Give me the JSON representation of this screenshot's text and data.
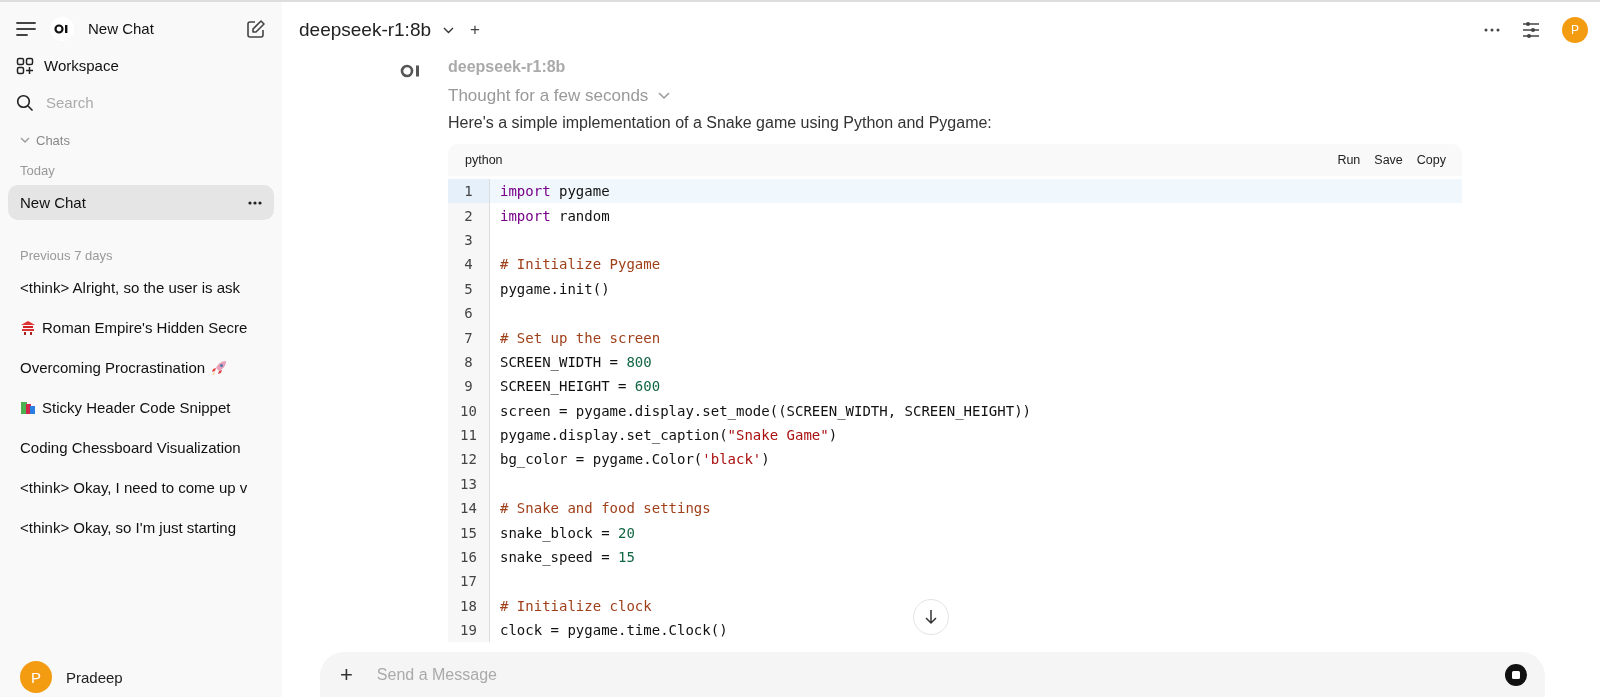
{
  "sidebar": {
    "title": "New Chat",
    "workspace": "Workspace",
    "search": {
      "placeholder": "Search"
    },
    "chats_label": "Chats",
    "chats_expanded": true,
    "groups": [
      {
        "label": "Today",
        "items": [
          {
            "title": "New Chat",
            "selected": true
          }
        ]
      },
      {
        "label": "Previous 7 days",
        "items": [
          {
            "title": "<think> Alright, so the user is ask",
            "selected": false
          },
          {
            "title": "Roman Empire's Hidden Secre",
            "selected": false,
            "kind": "lead_icon"
          },
          {
            "title": "Overcoming Procrastination",
            "selected": false,
            "kind": "trail_icon"
          },
          {
            "title": "Sticky Header Code Snippet",
            "selected": false,
            "kind": "lead_icon"
          },
          {
            "title": "Coding Chessboard Visualization",
            "selected": false
          },
          {
            "title": "<think> Okay, I need to come up v",
            "selected": false
          },
          {
            "title": "<think> Okay, so I'm just starting",
            "selected": false
          }
        ]
      }
    ],
    "user": {
      "initial": "P",
      "name": "Pradeep"
    }
  },
  "header": {
    "model": "deepseek-r1:8b",
    "add": "+",
    "avatar": "P"
  },
  "message": {
    "model": "deepseek-r1:8b",
    "thought": "Thought for a few seconds",
    "thought_expanded": false,
    "text": "Here's a simple implementation of a Snake game using Python and Pygame:",
    "code": {
      "language": "python",
      "actions": [
        "Run",
        "Save",
        "Copy"
      ],
      "lines": [
        {
          "n": "1",
          "selected": true,
          "tokens": [
            {
              "kind": "keyword",
              "text": "import"
            },
            {
              "kind": "plain",
              "text": " pygame"
            }
          ]
        },
        {
          "n": "2",
          "selected": false,
          "tokens": [
            {
              "kind": "keyword",
              "text": "import"
            },
            {
              "kind": "plain",
              "text": " random"
            }
          ]
        },
        {
          "n": "3",
          "selected": false
        },
        {
          "n": "4",
          "selected": false,
          "tokens": [
            {
              "kind": "comment",
              "text": "# Initialize Pygame"
            }
          ]
        },
        {
          "n": "5",
          "selected": false,
          "tokens": [
            {
              "kind": "plain",
              "text": "pygame.init()"
            }
          ]
        },
        {
          "n": "6",
          "selected": false
        },
        {
          "n": "7",
          "selected": false,
          "tokens": [
            {
              "kind": "comment",
              "text": "# Set up the screen"
            }
          ]
        },
        {
          "n": "8",
          "selected": false,
          "tokens": [
            {
              "kind": "plain",
              "text": "SCREEN_WIDTH = "
            },
            {
              "kind": "number",
              "text": "800"
            }
          ]
        },
        {
          "n": "9",
          "selected": false,
          "tokens": [
            {
              "kind": "plain",
              "text": "SCREEN_HEIGHT = "
            },
            {
              "kind": "number",
              "text": "600"
            }
          ]
        },
        {
          "n": "10",
          "selected": false,
          "tokens": [
            {
              "kind": "plain",
              "text": "screen = pygame.display.set_mode((SCREEN_WIDTH, SCREEN_HEIGHT))"
            }
          ]
        },
        {
          "n": "11",
          "selected": false,
          "tokens": [
            {
              "kind": "plain",
              "text": "pygame.display.set_caption("
            },
            {
              "kind": "string",
              "text": "\"Snake Game\""
            },
            {
              "kind": "plain",
              "text": ")"
            }
          ]
        },
        {
          "n": "12",
          "selected": false,
          "tokens": [
            {
              "kind": "plain",
              "text": "bg_color = pygame.Color("
            },
            {
              "kind": "string",
              "text": "'black'"
            },
            {
              "kind": "plain",
              "text": ")"
            }
          ]
        },
        {
          "n": "13",
          "selected": false
        },
        {
          "n": "14",
          "selected": false,
          "tokens": [
            {
              "kind": "comment",
              "text": "# Snake and food settings"
            }
          ]
        },
        {
          "n": "15",
          "selected": false,
          "tokens": [
            {
              "kind": "plain",
              "text": "snake_block = "
            },
            {
              "kind": "number",
              "text": "20"
            }
          ]
        },
        {
          "n": "16",
          "selected": false,
          "tokens": [
            {
              "kind": "plain",
              "text": "snake_speed = "
            },
            {
              "kind": "number",
              "text": "15"
            }
          ]
        },
        {
          "n": "17",
          "selected": false
        },
        {
          "n": "18",
          "selected": false,
          "tokens": [
            {
              "kind": "comment",
              "text": "# Initialize clock"
            }
          ]
        },
        {
          "n": "19",
          "selected": false,
          "tokens": [
            {
              "kind": "plain",
              "text": "clock = pygame.time.Clock()"
            }
          ]
        }
      ]
    }
  },
  "composer": {
    "add": "+",
    "placeholder": "Send a Message"
  }
}
